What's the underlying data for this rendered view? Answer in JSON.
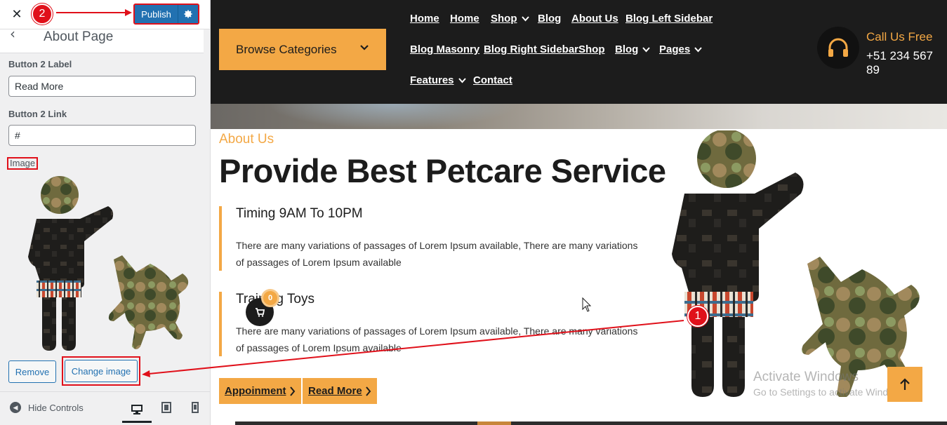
{
  "customizer": {
    "close_label": "✕",
    "step2_badge": "2",
    "publish_label": "Publish",
    "back_icon": "chevron-left-icon",
    "section_title": "About Page",
    "button2_label_title": "Button 2 Label",
    "button2_label_value": "Read More",
    "button2_link_title": "Button 2 Link",
    "button2_link_value": "#",
    "image_title": "Image",
    "remove_label": "Remove",
    "change_image_label": "Change image",
    "hide_controls_label": "Hide Controls",
    "devices": [
      "desktop-icon",
      "tablet-icon",
      "mobile-icon"
    ]
  },
  "site": {
    "browse_label": "Browse Categories",
    "nav_row1": [
      "Home",
      "Home",
      "Shop",
      "Blog",
      "About Us",
      "Blog Left Sidebar"
    ],
    "nav_row2": [
      "Blog Masonry",
      "Blog Right Sidebar",
      "Shop",
      "Blog",
      "Pages"
    ],
    "nav_row3": [
      "Features",
      "Contact"
    ],
    "call_label": "Call Us Free",
    "call_number": "+51 234 567 89",
    "about_kicker": "About Us",
    "about_title": "Provide Best Petcare Service",
    "feature1_title": "Timing 9AM To 10PM",
    "feature1_text": "There are many variations of passages of Lorem Ipsum available, There are many variations of passages of Lorem Ipsum available",
    "feature2_title": "Training Toys",
    "feature2_text": "There are many variations of passages of Lorem Ipsum available, There are many variations of passages of Lorem Ipsum available",
    "btn_appointment": "Appoinment",
    "btn_read_more": "Read More",
    "cart_count": "0",
    "step1_badge": "1",
    "activate_title": "Activate Windows",
    "activate_sub": "Go to Settings to activate Windows."
  },
  "colors": {
    "accent": "#f3a845",
    "header_bg": "#1c1c1c",
    "wp_blue": "#2271b1",
    "annotation_red": "#e0101a"
  }
}
